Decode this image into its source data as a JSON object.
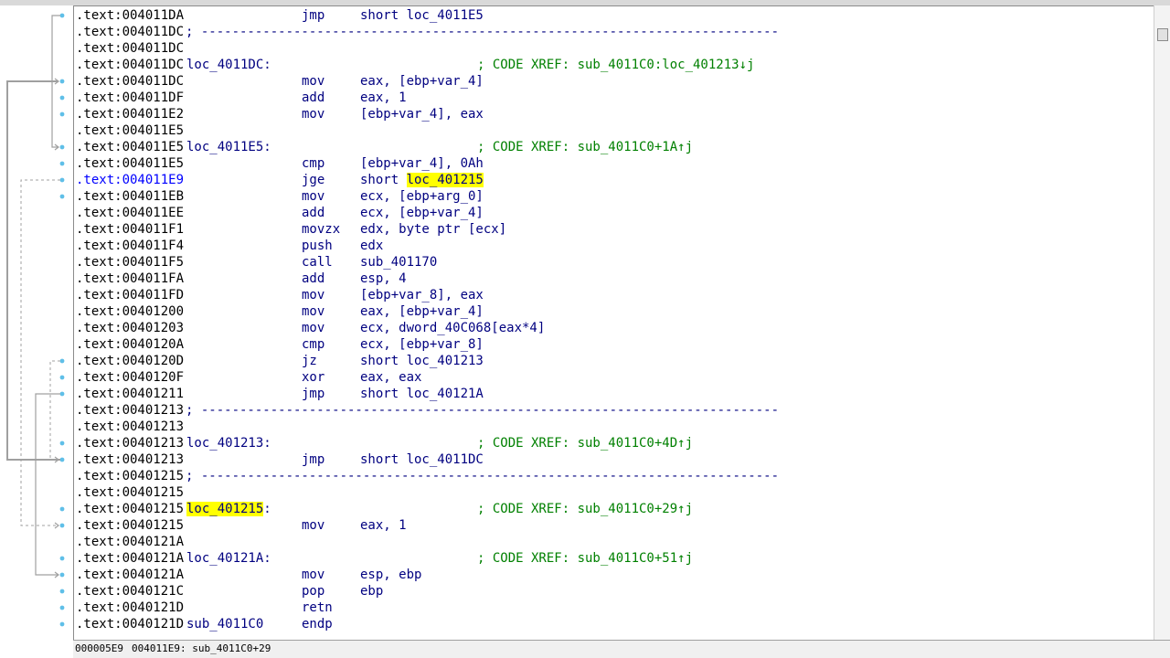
{
  "colors": {
    "address": "#000000",
    "address_current": "#0000ff",
    "code": "#000080",
    "comment": "#008000",
    "highlight": "#ffff00",
    "gutter_dot": "#5fbfe8",
    "arrow_solid": "#a0a0a0",
    "arrow_dashed": "#a0a0a0"
  },
  "listing": {
    "lines": [
      {
        "addr": ".text:004011DA",
        "label": "",
        "mnem": "jmp",
        "op": "short loc_4011E5",
        "comment": "",
        "sep": ""
      },
      {
        "addr": ".text:004011DC",
        "label": "",
        "mnem": "",
        "op": "",
        "comment": "",
        "sep": "; ---------------------------------------------------------------------------"
      },
      {
        "addr": ".text:004011DC",
        "label": "",
        "mnem": "",
        "op": "",
        "comment": "",
        "sep": ""
      },
      {
        "addr": ".text:004011DC",
        "label": "loc_4011DC:",
        "mnem": "",
        "op": "",
        "comment": "; CODE XREF: sub_4011C0:loc_401213↓j",
        "sep": ""
      },
      {
        "addr": ".text:004011DC",
        "label": "",
        "mnem": "mov",
        "op": "eax, [ebp+var_4]",
        "comment": "",
        "sep": ""
      },
      {
        "addr": ".text:004011DF",
        "label": "",
        "mnem": "add",
        "op": "eax, 1",
        "comment": "",
        "sep": ""
      },
      {
        "addr": ".text:004011E2",
        "label": "",
        "mnem": "mov",
        "op": "[ebp+var_4], eax",
        "comment": "",
        "sep": ""
      },
      {
        "addr": ".text:004011E5",
        "label": "",
        "mnem": "",
        "op": "",
        "comment": "",
        "sep": ""
      },
      {
        "addr": ".text:004011E5",
        "label": "loc_4011E5:",
        "mnem": "",
        "op": "",
        "comment": "; CODE XREF: sub_4011C0+1A↑j",
        "sep": ""
      },
      {
        "addr": ".text:004011E5",
        "label": "",
        "mnem": "cmp",
        "op": "[ebp+var_4], 0Ah",
        "comment": "",
        "sep": ""
      },
      {
        "addr": ".text:004011E9",
        "label": "",
        "mnem": "jge",
        "op": "short ",
        "op_hl": "loc_401215",
        "comment": "",
        "sep": "",
        "current": true
      },
      {
        "addr": ".text:004011EB",
        "label": "",
        "mnem": "mov",
        "op": "ecx, [ebp+arg_0]",
        "comment": "",
        "sep": ""
      },
      {
        "addr": ".text:004011EE",
        "label": "",
        "mnem": "add",
        "op": "ecx, [ebp+var_4]",
        "comment": "",
        "sep": ""
      },
      {
        "addr": ".text:004011F1",
        "label": "",
        "mnem": "movzx",
        "op": "edx, byte ptr [ecx]",
        "comment": "",
        "sep": ""
      },
      {
        "addr": ".text:004011F4",
        "label": "",
        "mnem": "push",
        "op": "edx",
        "comment": "",
        "sep": ""
      },
      {
        "addr": ".text:004011F5",
        "label": "",
        "mnem": "call",
        "op": "sub_401170",
        "comment": "",
        "sep": ""
      },
      {
        "addr": ".text:004011FA",
        "label": "",
        "mnem": "add",
        "op": "esp, 4",
        "comment": "",
        "sep": ""
      },
      {
        "addr": ".text:004011FD",
        "label": "",
        "mnem": "mov",
        "op": "[ebp+var_8], eax",
        "comment": "",
        "sep": ""
      },
      {
        "addr": ".text:00401200",
        "label": "",
        "mnem": "mov",
        "op": "eax, [ebp+var_4]",
        "comment": "",
        "sep": ""
      },
      {
        "addr": ".text:00401203",
        "label": "",
        "mnem": "mov",
        "op": "ecx, dword_40C068[eax*4]",
        "comment": "",
        "sep": ""
      },
      {
        "addr": ".text:0040120A",
        "label": "",
        "mnem": "cmp",
        "op": "ecx, [ebp+var_8]",
        "comment": "",
        "sep": ""
      },
      {
        "addr": ".text:0040120D",
        "label": "",
        "mnem": "jz",
        "op": "short loc_401213",
        "comment": "",
        "sep": ""
      },
      {
        "addr": ".text:0040120F",
        "label": "",
        "mnem": "xor",
        "op": "eax, eax",
        "comment": "",
        "sep": ""
      },
      {
        "addr": ".text:00401211",
        "label": "",
        "mnem": "jmp",
        "op": "short loc_40121A",
        "comment": "",
        "sep": ""
      },
      {
        "addr": ".text:00401213",
        "label": "",
        "mnem": "",
        "op": "",
        "comment": "",
        "sep": "; ---------------------------------------------------------------------------"
      },
      {
        "addr": ".text:00401213",
        "label": "",
        "mnem": "",
        "op": "",
        "comment": "",
        "sep": ""
      },
      {
        "addr": ".text:00401213",
        "label": "loc_401213:",
        "mnem": "",
        "op": "",
        "comment": "; CODE XREF: sub_4011C0+4D↑j",
        "sep": ""
      },
      {
        "addr": ".text:00401213",
        "label": "",
        "mnem": "jmp",
        "op": "short loc_4011DC",
        "comment": "",
        "sep": ""
      },
      {
        "addr": ".text:00401215",
        "label": "",
        "mnem": "",
        "op": "",
        "comment": "",
        "sep": "; ---------------------------------------------------------------------------"
      },
      {
        "addr": ".text:00401215",
        "label": "",
        "mnem": "",
        "op": "",
        "comment": "",
        "sep": ""
      },
      {
        "addr": ".text:00401215",
        "label": "",
        "label_hl": "loc_401215",
        "label_suffix": ":",
        "mnem": "",
        "op": "",
        "comment": "; CODE XREF: sub_4011C0+29↑j",
        "sep": ""
      },
      {
        "addr": ".text:00401215",
        "label": "",
        "mnem": "mov",
        "op": "eax, 1",
        "comment": "",
        "sep": ""
      },
      {
        "addr": ".text:0040121A",
        "label": "",
        "mnem": "",
        "op": "",
        "comment": "",
        "sep": ""
      },
      {
        "addr": ".text:0040121A",
        "label": "loc_40121A:",
        "mnem": "",
        "op": "",
        "comment": "; CODE XREF: sub_4011C0+51↑j",
        "sep": ""
      },
      {
        "addr": ".text:0040121A",
        "label": "",
        "mnem": "mov",
        "op": "esp, ebp",
        "comment": "",
        "sep": ""
      },
      {
        "addr": ".text:0040121C",
        "label": "",
        "mnem": "pop",
        "op": "ebp",
        "comment": "",
        "sep": ""
      },
      {
        "addr": ".text:0040121D",
        "label": "",
        "mnem": "retn",
        "op": "",
        "comment": "",
        "sep": ""
      },
      {
        "addr": ".text:0040121D",
        "label": "sub_4011C0",
        "mnem": "endp",
        "op": "",
        "comment": "",
        "sep": ""
      }
    ]
  },
  "gutter": {
    "dot_rows": [
      0,
      4,
      5,
      6,
      8,
      9,
      10,
      11,
      21,
      22,
      23,
      26,
      27,
      30,
      31,
      33,
      34,
      35,
      36,
      37
    ]
  },
  "statusbar": {
    "offset": "000005E9",
    "location": "004011E9: sub_4011C0+29"
  }
}
